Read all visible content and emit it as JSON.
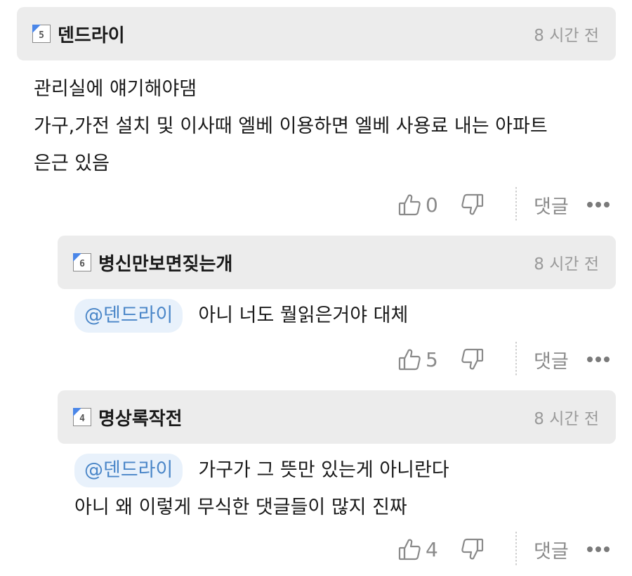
{
  "comments": [
    {
      "level": "5",
      "author": "덴드라이",
      "time": "8 시간 전",
      "mention": "",
      "lines": [
        "관리실에 얘기해야댐",
        "가구,가전 설치 및 이사때 엘베 이용하면 엘베 사용료 내는 아파트",
        "은근 있음"
      ],
      "likes": "0",
      "reply_label": "댓글"
    },
    {
      "level": "6",
      "author": "병신만보면짖는개",
      "time": "8 시간 전",
      "mention": "@덴드라이",
      "lines": [
        "아니 너도 뭘읽은거야 대체"
      ],
      "likes": "5",
      "reply_label": "댓글"
    },
    {
      "level": "4",
      "author": "명상록작전",
      "time": "8 시간 전",
      "mention": "@덴드라이",
      "lines": [
        "가구가 그 뜻만 있는게 아니란다",
        "아니 왜 이렇게 무식한 댓글들이 많지 진짜"
      ],
      "likes": "4",
      "reply_label": "댓글"
    }
  ],
  "icons": {
    "like": "thumbs-up-icon",
    "dislike": "thumbs-down-icon",
    "more": "more-dots-icon",
    "badge_accent": "#4a86e8"
  },
  "colors": {
    "header_bg": "#ececec",
    "mention_bg": "#e8f1fb",
    "mention_text": "#4a86c8",
    "muted_text": "#9a9a9a"
  }
}
